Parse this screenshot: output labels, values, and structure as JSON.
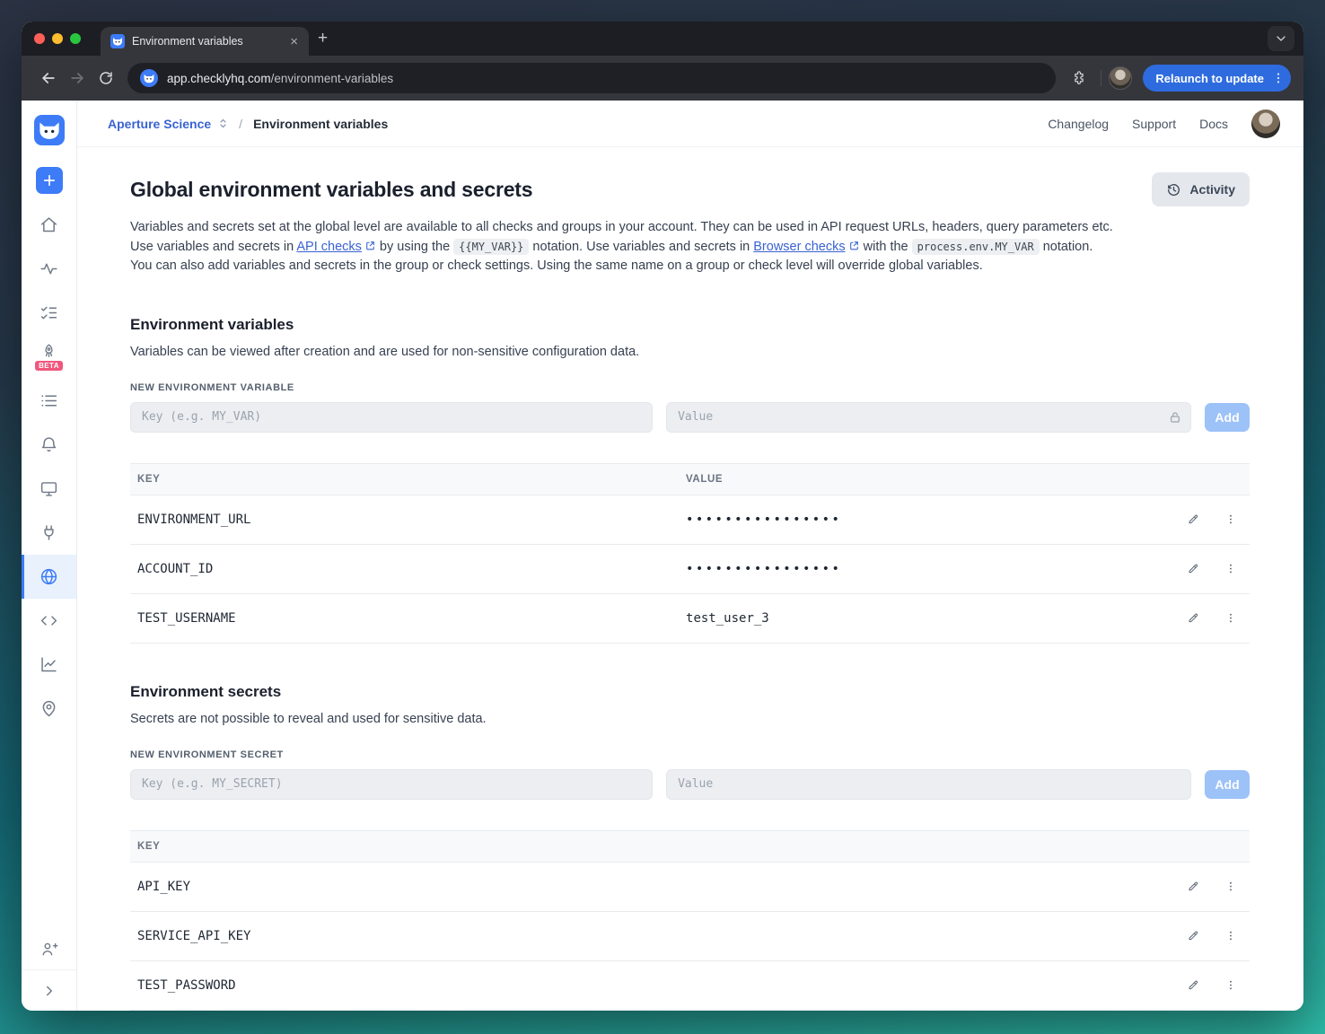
{
  "browser": {
    "tab": {
      "title": "Environment variables",
      "close": "×",
      "new_tab": "+"
    },
    "url": {
      "host": "app.checklyhq.com",
      "path": "/environment-variables"
    },
    "relaunch_label": "Relaunch to update"
  },
  "header": {
    "account": "Aperture Science",
    "separator": "/",
    "current": "Environment variables",
    "links": [
      "Changelog",
      "Support",
      "Docs"
    ]
  },
  "sidebar": {
    "beta_badge": "BETA"
  },
  "page": {
    "title": "Global environment variables and secrets",
    "activity": "Activity",
    "intro": {
      "p1": "Variables and secrets set at the global level are available to all checks and groups in your account. They can be used in API request URLs, headers, query parameters etc. Use variables and secrets in ",
      "link1": "API checks",
      "p2": " by using the ",
      "code1": "{{MY_VAR}}",
      "p3": " notation. Use variables and secrets in ",
      "link2": "Browser checks",
      "p4": " with the ",
      "code2": "process.env.MY_VAR",
      "p5": " notation. You can also add variables and secrets in the group or check settings. Using the same name on a group or check level will override global variables."
    },
    "variables": {
      "heading": "Environment variables",
      "description": "Variables can be viewed after creation and are used for non-sensitive configuration data.",
      "form_label": "NEW ENVIRONMENT VARIABLE",
      "key_placeholder": "Key (e.g. MY_VAR)",
      "value_placeholder": "Value",
      "add": "Add",
      "col_key": "KEY",
      "col_value": "VALUE",
      "rows": [
        {
          "key": "ENVIRONMENT_URL",
          "value": "••••••••••••••••",
          "masked": true
        },
        {
          "key": "ACCOUNT_ID",
          "value": "••••••••••••••••",
          "masked": true
        },
        {
          "key": "TEST_USERNAME",
          "value": "test_user_3",
          "masked": false
        }
      ]
    },
    "secrets": {
      "heading": "Environment secrets",
      "description": "Secrets are not possible to reveal and used for sensitive data.",
      "form_label": "NEW ENVIRONMENT SECRET",
      "key_placeholder": "Key (e.g. MY_SECRET)",
      "value_placeholder": "Value",
      "add": "Add",
      "col_key": "KEY",
      "rows": [
        {
          "key": "API_KEY"
        },
        {
          "key": "SERVICE_API_KEY"
        },
        {
          "key": "TEST_PASSWORD"
        }
      ]
    }
  }
}
